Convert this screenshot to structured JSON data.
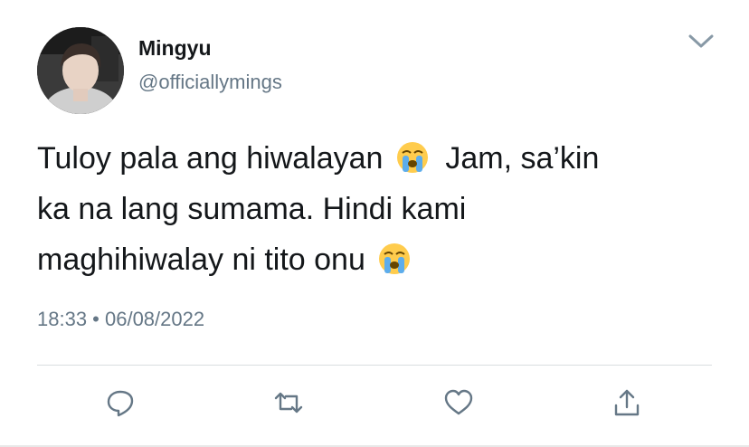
{
  "author": {
    "name": "Mingyu",
    "handle": "@officiallymings"
  },
  "tweet": {
    "line1_a": "Tuloy pala ang hiwalayan",
    "line1_b": "Jam, sa’kin",
    "line2": "ka na lang sumama. Hindi kami",
    "line3": "maghihiwalay ni tito onu",
    "emoji": "loudly-crying-face"
  },
  "timestamp": "18:33 • 06/08/2022",
  "actions": [
    "reply-icon",
    "retweet-icon",
    "like-icon",
    "share-icon"
  ],
  "colors": {
    "text": "#14171a",
    "secondary": "#657786",
    "icon": "#657786",
    "divider": "#d9dde0"
  }
}
